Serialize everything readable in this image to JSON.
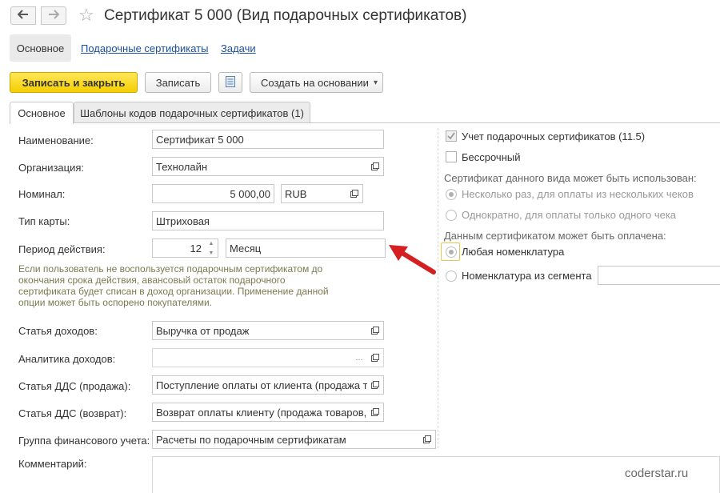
{
  "window": {
    "title": "Сертификат 5 000 (Вид подарочных сертификатов)",
    "back_icon": "arrow-left-icon",
    "forward_icon": "arrow-right-icon",
    "favorite_icon": "star-icon"
  },
  "nav_tabs": {
    "main": "Основное",
    "certificates": "Подарочные сертификаты",
    "tasks": "Задачи"
  },
  "toolbar": {
    "save_close": "Записать и закрыть",
    "save": "Записать",
    "list_icon": "document-icon",
    "create_based": "Создать на основании",
    "create_based_arrow": "▾"
  },
  "inner_tabs": {
    "main": "Основное",
    "templates": "Шаблоны кодов подарочных сертификатов (1)"
  },
  "form": {
    "name_label": "Наименование:",
    "name_value": "Сертификат 5 000",
    "org_label": "Организация:",
    "org_value": "Технолайн",
    "nominal_label": "Номинал:",
    "nominal_value": "5 000,00",
    "currency_value": "RUB",
    "card_type_label": "Тип карты:",
    "card_type_value": "Штриховая",
    "period_label": "Период действия:",
    "period_value": "12",
    "period_unit": "Месяц",
    "hint": "Если пользователь не воспользуется подарочным сертификатом до окончания срока действия, авансовый остаток подарочного сертификата будет списан в доход организации. Применение данной опции может быть оспорено покупателями.",
    "income_item_label": "Статья доходов:",
    "income_item_value": "Выручка от продаж",
    "income_analytics_label": "Аналитика доходов:",
    "income_analytics_value": "",
    "dds_sale_label": "Статья ДДС (продажа):",
    "dds_sale_value": "Поступление оплаты от клиента (продажа тов",
    "dds_return_label": "Статья ДДС (возврат):",
    "dds_return_value": "Возврат оплаты клиенту (продажа товаров, ",
    "fin_group_label": "Группа финансового учета:",
    "fin_group_value": "Расчеты по подарочным сертификатам",
    "comment_label": "Комментарий:",
    "comment_value": "",
    "ellipsis": "..."
  },
  "right": {
    "accounting_label": "Учет подарочных сертификатов (11.5)",
    "accounting_checked": true,
    "unlimited_label": "Бессрочный",
    "unlimited_checked": false,
    "usage_title": "Сертификат данного вида может быть использован:",
    "usage_multi": "Несколько раз, для оплаты из нескольких чеков",
    "usage_once": "Однократно, для оплаты только одного чека",
    "pay_title": "Данным сертификатом может быть оплачена:",
    "pay_any": "Любая номенклатура",
    "pay_segment": "Номенклатура из сегмента",
    "segment_value": ""
  },
  "annotation": {
    "arrow_color": "#d42020"
  },
  "watermark": "coderstar.ru",
  "colors": {
    "primary_button": "#f5cf00",
    "link": "#1a4f9c",
    "hint_text": "#7a7a50"
  }
}
